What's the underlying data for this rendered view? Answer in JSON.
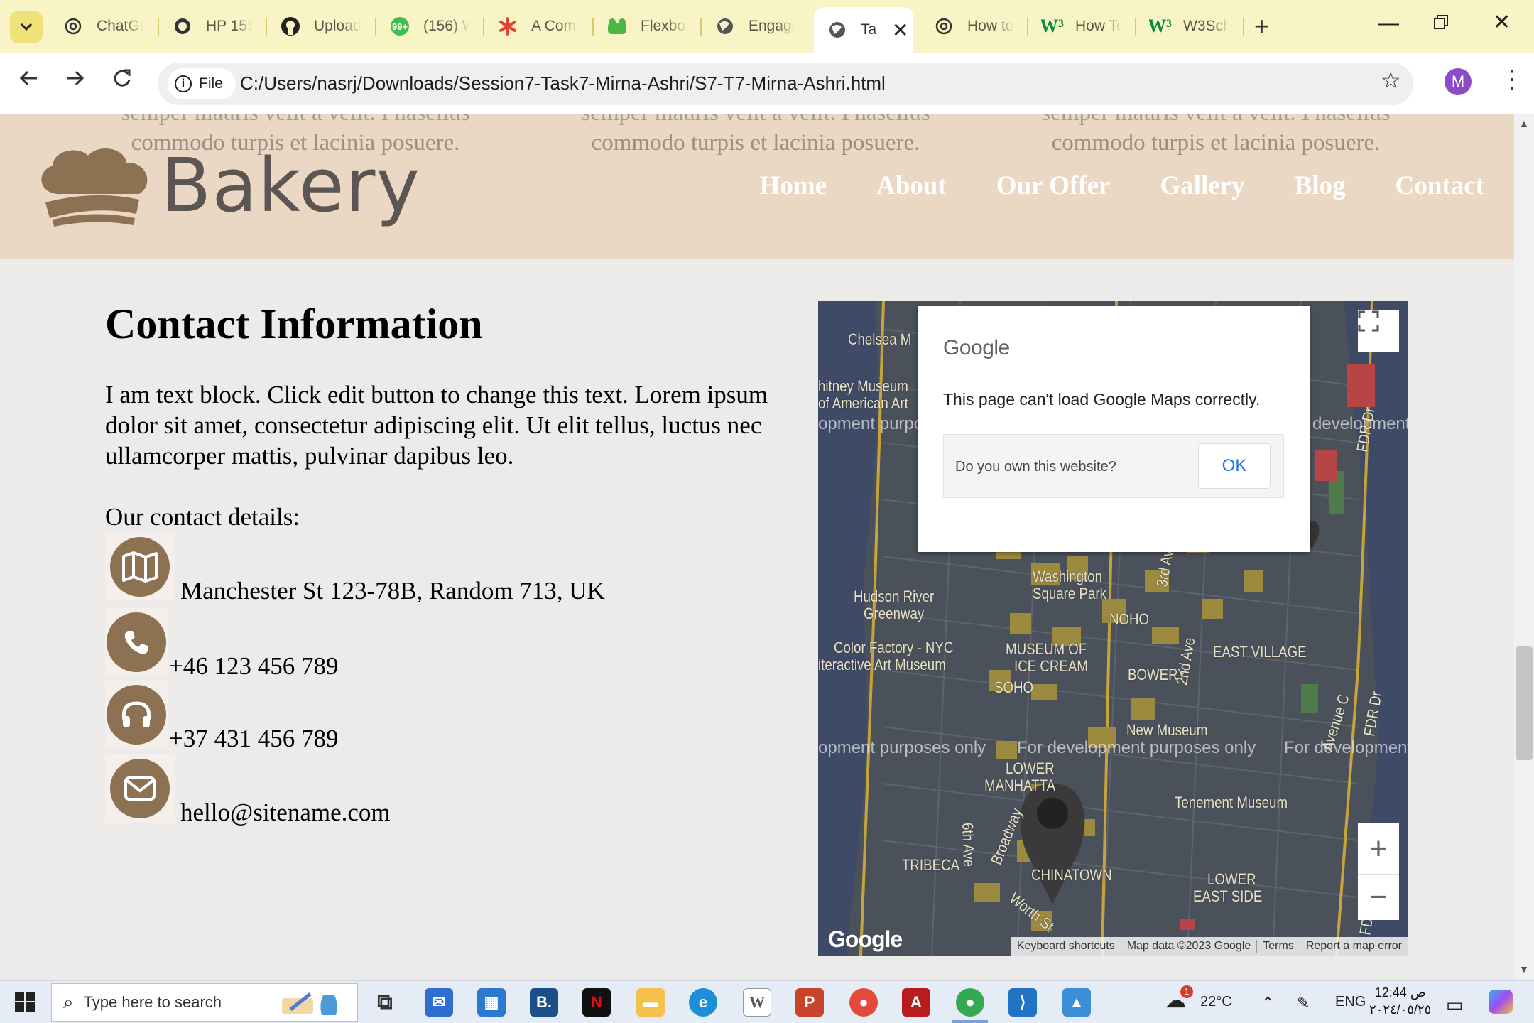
{
  "browser": {
    "tabs": [
      {
        "label": "ChatGP",
        "icon": "chatgpt-icon"
      },
      {
        "label": "HP 15S",
        "icon": "globe-icon"
      },
      {
        "label": "Upload",
        "icon": "github-icon"
      },
      {
        "label": "(156) W",
        "icon": "whatsapp-icon"
      },
      {
        "label": "A Comp",
        "icon": "asterisk-icon"
      },
      {
        "label": "Flexbox",
        "icon": "frog-icon"
      },
      {
        "label": "Engage",
        "icon": "globe-icon"
      },
      {
        "label": "Ta",
        "icon": "globe-icon",
        "active": true
      },
      {
        "label": "How to",
        "icon": "chatgpt-icon"
      },
      {
        "label": "How To",
        "icon": "w3-icon"
      },
      {
        "label": "W3Sch",
        "icon": "w3-icon"
      }
    ],
    "address": {
      "scheme_chip": "File",
      "url": "C:/Users/nasrj/Downloads/Session7-Task7-Mirna-Ashri/S7-T7-Mirna-Ashri.html"
    },
    "profile_initial": "M"
  },
  "site": {
    "brand": "Bakery",
    "ghost_text": "commodo turpis et lacinia posuere.",
    "ghost_text_top": "semper mauris velit a velit. Phasellus",
    "nav": [
      "Home",
      "About",
      "Our Offer",
      "Gallery",
      "Blog",
      "Contact"
    ],
    "title": "Contact Information",
    "intro": "I am text block. Click edit button to change this text. Lorem ipsum dolor sit amet, consectetur adipiscing elit. Ut elit tellus, luctus nec ullamcorper mattis, pulvinar dapibus leo.",
    "details_label": "Our contact details:",
    "contacts": [
      {
        "icon": "map-icon",
        "text": "Manchester St 123-78B, Random 713, UK"
      },
      {
        "icon": "phone-icon",
        "text": "+46 123 456 789"
      },
      {
        "icon": "headset-icon",
        "text": "+37 431 456 789"
      },
      {
        "icon": "envelope-icon",
        "text": "hello@sitename.com"
      }
    ],
    "accent": "#8c7153",
    "header_bg": "#ead8c5"
  },
  "map": {
    "dialog": {
      "brand": "Google",
      "message": "This page can't load Google Maps correctly.",
      "question": "Do you own this website?",
      "ok": "OK"
    },
    "labels": {
      "chelsea": "Chelsea M",
      "whitney1": "hitney Museum",
      "whitney2": "of American Art",
      "hudson1": "Hudson River",
      "hudson2": "Greenway",
      "colorfactory1": "Color Factory - NYC",
      "colorfactory2": "iteractive Art Museum",
      "washington1": "Washington",
      "washington2": "Square Park",
      "noho": "NOHO",
      "icecream1": "MUSEUM OF",
      "icecream2": "ICE CREAM",
      "eastvillage": "EAST VILLAGE",
      "bowery": "BOWERY",
      "soho": "SOHO",
      "newmuseum": "New Museum",
      "lower": "LOWER",
      "manhattan": "MANHATTA",
      "tenement": "Tenement Museum",
      "tribeca": "TRIBECA",
      "chinatown": "CHINATOWN",
      "lowereast1": "LOWER",
      "lowereast2": "EAST SIDE",
      "ave3": "3rd Ave",
      "ave2": "2nd Ave",
      "ave6": "6th Ave",
      "broadway": "Broadway",
      "worth": "Worth St",
      "avec": "Avenue C",
      "fdr": "FDR Dr",
      "fdr2": "FDR Dr",
      "fdr3": "FDR Dr"
    },
    "dev_watermark": "For development purposes only",
    "dev_left": "opment purpos",
    "dev_right": "development",
    "dev_mid_left": "opment purposes only",
    "dev_mid_right": "For development",
    "google_mark": "Google",
    "attribution": [
      "Keyboard shortcuts",
      "Map data ©2023 Google",
      "Terms",
      "Report a map error"
    ]
  },
  "taskbar": {
    "search_placeholder": "Type here to search",
    "weather": "22°C",
    "weather_badge": "1",
    "lang": "ENG",
    "time": "12:44 ص",
    "date": "٢٠٢٤/٠٥/٢٥"
  }
}
